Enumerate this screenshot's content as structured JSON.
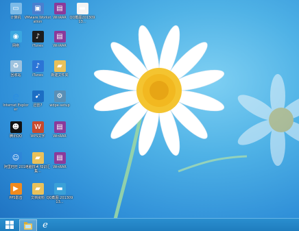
{
  "taskbar": {
    "start": "Start",
    "pinned": [
      "Explorer",
      "Internet Explorer"
    ]
  },
  "desktop_icons": [
    {
      "label": "计算机",
      "icon": "computer-icon",
      "color": "#7dbbe8"
    },
    {
      "label": "VMware Workstation",
      "icon": "vmware-icon",
      "color": "#4a7fcf"
    },
    {
      "label": "WinRAR",
      "icon": "winrar-icon",
      "color": "#8b3a9a"
    },
    {
      "label": "QQ截图20130913...",
      "icon": "screenshot-icon",
      "color": "#f4f4f4"
    },
    {
      "label": "网络",
      "icon": "network-icon",
      "color": "#3aa7e0"
    },
    {
      "label": "iTunes",
      "icon": "itunes-icon",
      "color": "#1d1d1d"
    },
    {
      "label": "WinRAR",
      "icon": "winrar-icon",
      "color": "#8b3a9a"
    },
    {
      "label": "回收站",
      "icon": "recycle-bin-icon",
      "color": "#9dc2de"
    },
    {
      "label": "iTunes",
      "icon": "itunes-icon",
      "color": "#2b75d6"
    },
    {
      "label": "新建文件夹",
      "icon": "folder-icon",
      "color": "#e9c15a"
    },
    {
      "label": "Internet Explorer",
      "icon": "ie-icon",
      "color": "#2d8fe0"
    },
    {
      "label": "迅雷7",
      "icon": "thunder-icon",
      "color": "#1c6ec4"
    },
    {
      "label": "wdpe-setup",
      "icon": "setup-icon",
      "color": "#5a8fb5"
    },
    {
      "label": "腾讯QQ",
      "icon": "qq-icon",
      "color": "#111111"
    },
    {
      "label": "WPS文字",
      "icon": "wps-icon",
      "color": "#c84a2e"
    },
    {
      "label": "WinRAR",
      "icon": "winrar-icon",
      "color": "#8b3a9a"
    },
    {
      "label": "阿里旺旺 2013",
      "icon": "aliwangwang-icon",
      "color": "#2e86d8"
    },
    {
      "label": "电脑技术 知识汇集...",
      "icon": "folder-icon",
      "color": "#e9c15a"
    },
    {
      "label": "WinRAR",
      "icon": "winrar-icon",
      "color": "#8b3a9a"
    },
    {
      "label": "PPS影音",
      "icon": "pps-icon",
      "color": "#f08a1e"
    },
    {
      "label": "文档资料",
      "icon": "folder-icon",
      "color": "#e9c15a"
    },
    {
      "label": "QQ截图 20130913...",
      "icon": "screenshot-icon",
      "color": "#3aa1d8"
    }
  ]
}
